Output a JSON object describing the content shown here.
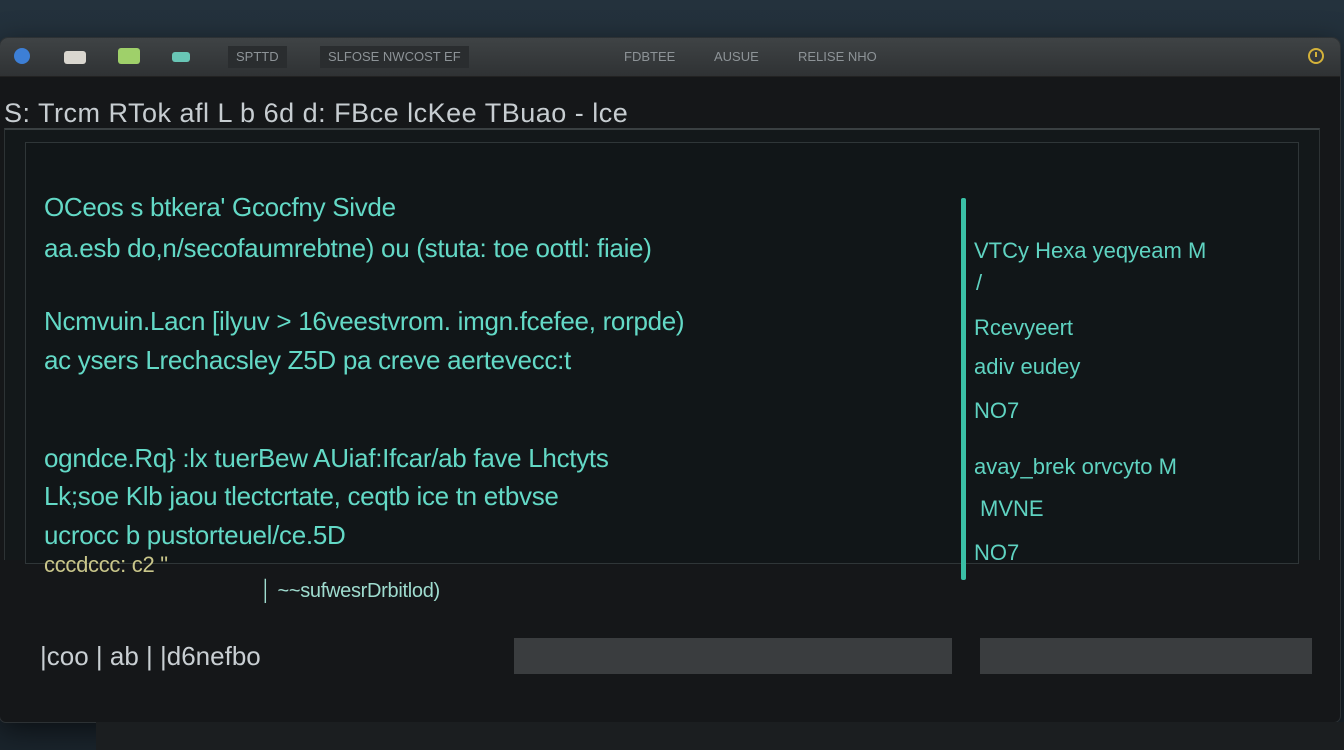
{
  "titlebar": {
    "tabs": [
      "SPTTD",
      "SLFOSE NWCOST EF"
    ],
    "center_items": [
      "FDBTEE",
      "AUSUE",
      "RELISE NHO"
    ],
    "icons": [
      "app-icon",
      "folder-icon",
      "image-icon",
      "terminal-icon",
      "clock-icon"
    ]
  },
  "heading": "S: Trcm RTok afl L b 6d  d: FBce lcKee TBuao - lce",
  "main": {
    "lines": [
      "OCeos s btkera' Gcocfny Sivde",
      "aa.esb do,n/secofaumrebtne) ou (stuta: toe oottl: fiaie)",
      "Ncmvuin.Lacn [ilyuv > 16veestvrom. imgn.fcefee, rorpde)",
      "ac ysers Lrechacsley Z5D pa creve aertevecc:t",
      "ogndce.Rq} :lx tuerBew AUiaf:Ifcar/ab fave Lhctyts",
      "Lk;soe Klb jaou tlectcrtate, ceqtb ice tn etbvse",
      "ucrocc b pustorteuel/ce.5D",
      "cccdccc: c2 \"",
      "│   ~~sufwesrDrbitlod)"
    ]
  },
  "side": {
    "items": [
      "VTCy  Hexa yeqyeam M",
      "/",
      "Rcevyeert",
      "adiv eudey",
      "NO7",
      "avay_brek orvcyto M",
      "MVNE",
      "NO7"
    ]
  },
  "input": {
    "text": "|coo  |  ab  |  |d6nefbo",
    "side_value": ""
  },
  "colors": {
    "accent": "#3ac0a6",
    "text_teal": "#63d9c6",
    "text_yellow": "#c9c68a",
    "clock": "#d4b23a"
  }
}
